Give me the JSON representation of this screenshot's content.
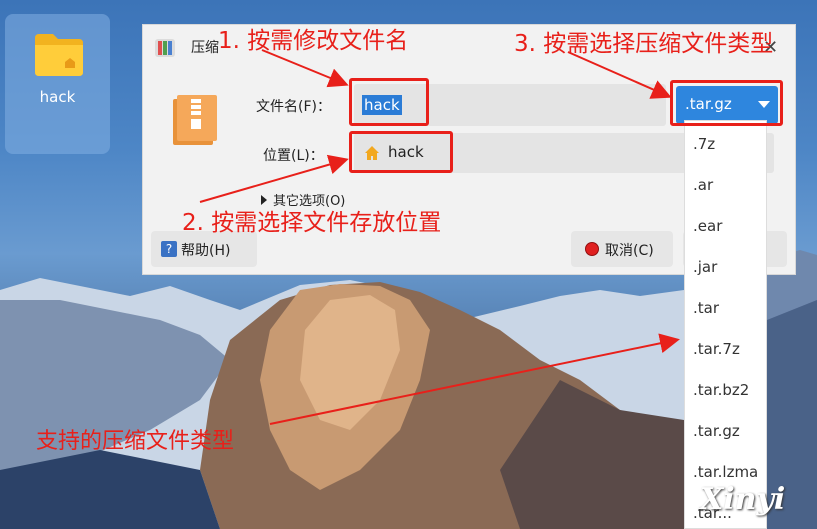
{
  "desktop": {
    "icon_label": "hack"
  },
  "dialog": {
    "title": "压缩",
    "close": "✕",
    "filename_label": "文件名(F)：",
    "filename_value": "hack",
    "extension_selected": ".tar.gz",
    "location_label": "位置(L)：",
    "location_value": "hack",
    "more_options": "其它选项(O)",
    "help_button": "帮助(H)",
    "cancel_button": "取消(C)",
    "ok_button_partial": ")"
  },
  "extensions": [
    ".7z",
    ".ar",
    ".ear",
    ".jar",
    ".tar",
    ".tar.7z",
    ".tar.bz2",
    ".tar.gz",
    ".tar.lzma",
    ".tar..."
  ],
  "annotations": {
    "step1": "1. 按需修改文件名",
    "step2": "2.  按需选择文件存放位置",
    "step3": "3. 按需选择压缩文件类型",
    "supported": "支持的压缩文件类型"
  },
  "watermark": "Xinyi",
  "colors": {
    "accent": "#2e86de",
    "annotation": "#e8201a",
    "selection": "#2b7cd6"
  }
}
